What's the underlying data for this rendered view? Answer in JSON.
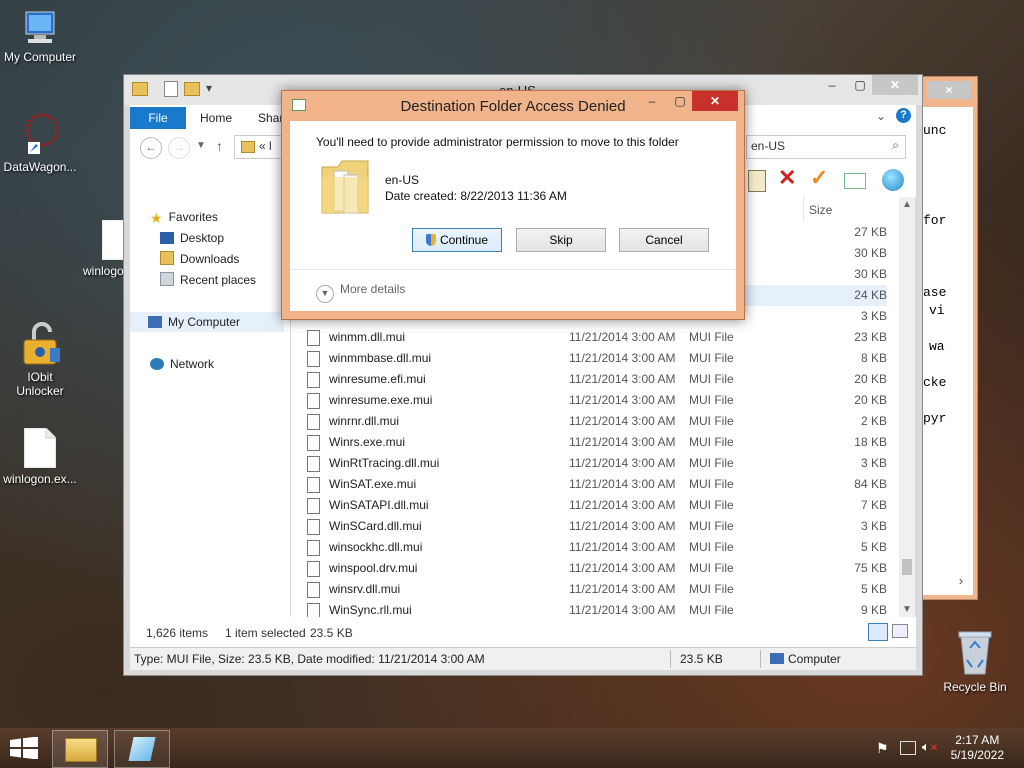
{
  "desktop": {
    "icons": [
      {
        "label": "My Computer"
      },
      {
        "label": "DataWagon..."
      },
      {
        "label": "winlogon"
      },
      {
        "label_line1": "IObit",
        "label_line2": "Unlocker"
      },
      {
        "label": "winlogon.ex..."
      },
      {
        "label": "Recycle Bin"
      }
    ]
  },
  "back_window": {
    "close_label": "×",
    "text_lines": [
      "unc",
      "for",
      "ase",
      "vi",
      "wa",
      "cke",
      "pyr"
    ]
  },
  "explorer": {
    "title": "en-US",
    "ribbon_tabs": [
      "File",
      "Home",
      "Shar"
    ],
    "address_partial": "«  l",
    "search_value": "en-US",
    "size_column": "Size",
    "nav": {
      "favorites": "Favorites",
      "desktop": "Desktop",
      "downloads": "Downloads",
      "recent": "Recent places",
      "computer": "My Computer",
      "network": "Network"
    },
    "partial_sizes": [
      "27 KB",
      "30 KB",
      "30 KB",
      "24 KB",
      "3 KB"
    ],
    "files": [
      {
        "name": "winmm.dll.mui",
        "date": "11/21/2014 3:00 AM",
        "type": "MUI File",
        "size": "23 KB"
      },
      {
        "name": "winmmbase.dll.mui",
        "date": "11/21/2014 3:00 AM",
        "type": "MUI File",
        "size": "8 KB"
      },
      {
        "name": "winresume.efi.mui",
        "date": "11/21/2014 3:00 AM",
        "type": "MUI File",
        "size": "20 KB"
      },
      {
        "name": "winresume.exe.mui",
        "date": "11/21/2014 3:00 AM",
        "type": "MUI File",
        "size": "20 KB"
      },
      {
        "name": "winrnr.dll.mui",
        "date": "11/21/2014 3:00 AM",
        "type": "MUI File",
        "size": "2 KB"
      },
      {
        "name": "Winrs.exe.mui",
        "date": "11/21/2014 3:00 AM",
        "type": "MUI File",
        "size": "18 KB"
      },
      {
        "name": "WinRtTracing.dll.mui",
        "date": "11/21/2014 3:00 AM",
        "type": "MUI File",
        "size": "3 KB"
      },
      {
        "name": "WinSAT.exe.mui",
        "date": "11/21/2014 3:00 AM",
        "type": "MUI File",
        "size": "84 KB"
      },
      {
        "name": "WinSATAPI.dll.mui",
        "date": "11/21/2014 3:00 AM",
        "type": "MUI File",
        "size": "7 KB"
      },
      {
        "name": "WinSCard.dll.mui",
        "date": "11/21/2014 3:00 AM",
        "type": "MUI File",
        "size": "3 KB"
      },
      {
        "name": "winsockhc.dll.mui",
        "date": "11/21/2014 3:00 AM",
        "type": "MUI File",
        "size": "5 KB"
      },
      {
        "name": "winspool.drv.mui",
        "date": "11/21/2014 3:00 AM",
        "type": "MUI File",
        "size": "75 KB"
      },
      {
        "name": "winsrv.dll.mui",
        "date": "11/21/2014 3:00 AM",
        "type": "MUI File",
        "size": "5 KB"
      },
      {
        "name": "WinSync.rll.mui",
        "date": "11/21/2014 3:00 AM",
        "type": "MUI File",
        "size": "9 KB"
      }
    ],
    "status": {
      "items": "1,626 items",
      "selected": "1 item selected",
      "selected_size": "23.5 KB"
    },
    "details": {
      "text": "Type: MUI File, Size: 23.5 KB, Date modified: 11/21/2014 3:00 AM",
      "size": "23.5 KB",
      "location": "Computer"
    }
  },
  "dialog": {
    "title": "Destination Folder Access Denied",
    "message": "You'll need to provide administrator permission to move to this folder",
    "folder_name": "en-US",
    "folder_date": "Date created: 8/22/2013 11:36 AM",
    "continue_label": "Continue",
    "skip_label": "Skip",
    "cancel_label": "Cancel",
    "more_details": "More details"
  },
  "taskbar": {
    "time": "2:17 AM",
    "date": "5/19/2022"
  },
  "colors": {
    "dialog_frame": "#f0b38a",
    "file_tab": "#1979ca",
    "close_button": "#c7302b"
  }
}
